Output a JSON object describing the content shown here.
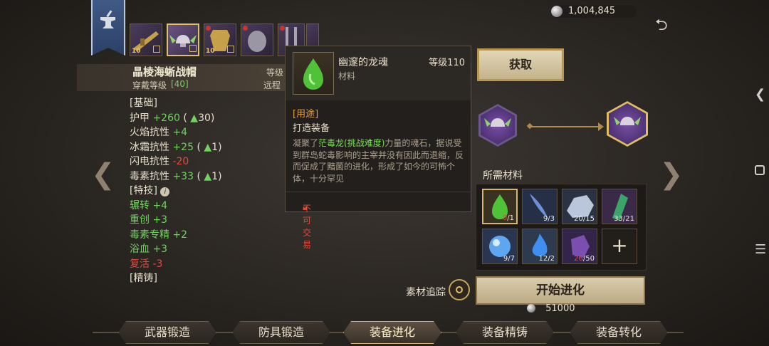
{
  "currency": {
    "amount": "1,004,845",
    "icon": "silver-coin-icon"
  },
  "item": {
    "name": "晶棱海蜥战帽",
    "wear_level_label": "穿戴等级",
    "wear_level_value": "[40]",
    "level_label_cut": "等级",
    "ranged_label_cut": "远程"
  },
  "thumbnails": [
    {
      "level": "10"
    },
    {
      "level": ""
    },
    {
      "level": "10"
    },
    {
      "level": ""
    },
    {
      "level": ""
    },
    {
      "level": ""
    }
  ],
  "stats": {
    "basic_header": "[基础]",
    "basic": [
      {
        "name": "护甲",
        "value": "+260",
        "extra": "( ",
        "extra_value": "30)"
      },
      {
        "name": "火焰抗性",
        "value": "+4"
      },
      {
        "name": "冰霜抗性",
        "value": "+25",
        "extra": "( ",
        "extra_value": "1)"
      },
      {
        "name": "闪电抗性",
        "value": "-20"
      },
      {
        "name": "毒素抗性",
        "value": "+33",
        "extra": "( ",
        "extra_value": "1)"
      }
    ],
    "skill_header": "[特技]",
    "skills": [
      {
        "name": "辗转",
        "value": "+4"
      },
      {
        "name": "重创",
        "value": "+3"
      },
      {
        "name": "毒素专精",
        "value": "+2"
      },
      {
        "name": "浴血",
        "value": "+3"
      },
      {
        "name": "复活",
        "value": "-3"
      }
    ],
    "forge_header": "[精铸]"
  },
  "tooltip": {
    "name": "幽邃的龙魂",
    "category": "材料",
    "level": "等级110",
    "use_header": "[用途]",
    "use": "打造装备",
    "desc_pre": "凝聚了",
    "desc_highlight": "茫毒龙(挑战难度)",
    "desc_post": "力量的魂石，据说受到群岛蛇毒影响的主宰并没有因此而退缩，反而促成了黯菌的进化，形成了如今的可怖个体，十分罕见",
    "untradeable": "不可交易"
  },
  "acquire_label": "获取",
  "materials_title": "所需材料",
  "materials": [
    {
      "icon": "green-soul-gem-icon",
      "have": "0",
      "need": "1",
      "short": true
    },
    {
      "icon": "blue-fang-icon",
      "have": "9",
      "need": "3",
      "short": false
    },
    {
      "icon": "silver-ore-icon",
      "have": "20",
      "need": "15",
      "short": false
    },
    {
      "icon": "green-crystal-icon",
      "have": "33",
      "need": "21",
      "short": false
    },
    {
      "icon": "blue-orb-icon",
      "have": "9",
      "need": "7",
      "short": false
    },
    {
      "icon": "blue-flame-icon",
      "have": "12",
      "need": "2",
      "short": false
    },
    {
      "icon": "purple-stone-icon",
      "have": "26",
      "need": "50",
      "short": true
    }
  ],
  "track_label": "素材追踪",
  "evolve_label": "开始进化",
  "evolve_cost": "51000",
  "tabs": [
    {
      "label": "武器锻造",
      "active": false
    },
    {
      "label": "防具锻造",
      "active": false
    },
    {
      "label": "装备进化",
      "active": true
    },
    {
      "label": "装备精铸",
      "active": false
    },
    {
      "label": "装备转化",
      "active": false
    }
  ],
  "colors": {
    "positive": "#6fd35e",
    "negative": "#e04a3e",
    "gold": "#d7b56a"
  }
}
